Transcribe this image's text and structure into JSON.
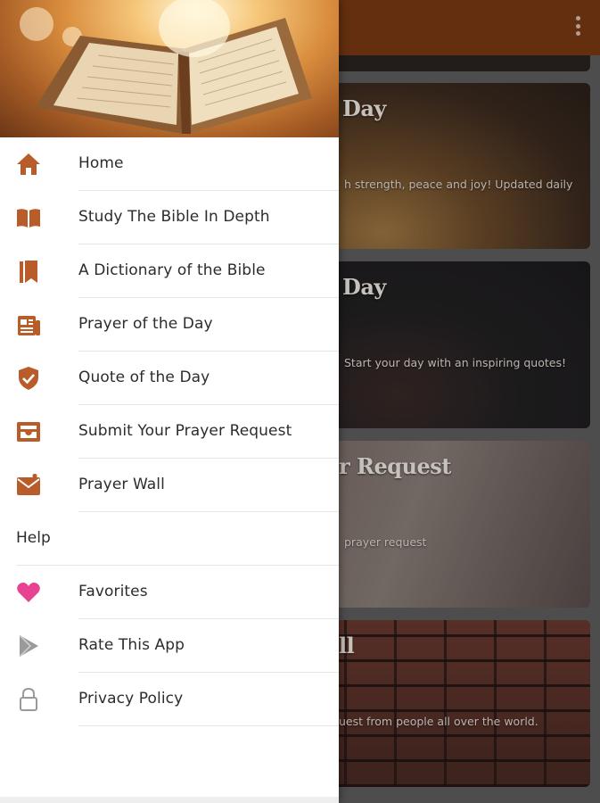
{
  "app": {
    "accent_color": "#b85c2a",
    "appbar_color": "#7a3a12",
    "overflow_icon": "more-vert-icon"
  },
  "cards": [
    {
      "title": "",
      "subtitle": ""
    },
    {
      "title": "Day",
      "subtitle": "h strength, peace and joy! Updated daily"
    },
    {
      "title": "Day",
      "subtitle": "Start your day with an inspiring quotes!"
    },
    {
      "title": "r Request",
      "subtitle": "prayer request"
    },
    {
      "title": "ll",
      "subtitle": "uest from people all over the world."
    }
  ],
  "drawer": {
    "header_image": "open-bible-sunlight-image",
    "items": [
      {
        "label": "Home",
        "icon": "home-icon"
      },
      {
        "label": "Study The Bible In Depth",
        "icon": "open-book-icon"
      },
      {
        "label": "A Dictionary of the Bible",
        "icon": "bookmark-book-icon"
      },
      {
        "label": "Prayer of the Day",
        "icon": "newspaper-icon"
      },
      {
        "label": "Quote of the Day",
        "icon": "verified-shield-icon"
      },
      {
        "label": "Submit Your Prayer Request",
        "icon": "inbox-tray-icon"
      },
      {
        "label": "Prayer Wall",
        "icon": "mail-heart-icon"
      }
    ],
    "section_label": "Help",
    "help_items": [
      {
        "label": "Favorites",
        "icon": "heart-icon",
        "color": "#e84393"
      },
      {
        "label": "Rate This App",
        "icon": "play-store-icon"
      },
      {
        "label": "Privacy Policy",
        "icon": "lock-icon"
      }
    ]
  }
}
